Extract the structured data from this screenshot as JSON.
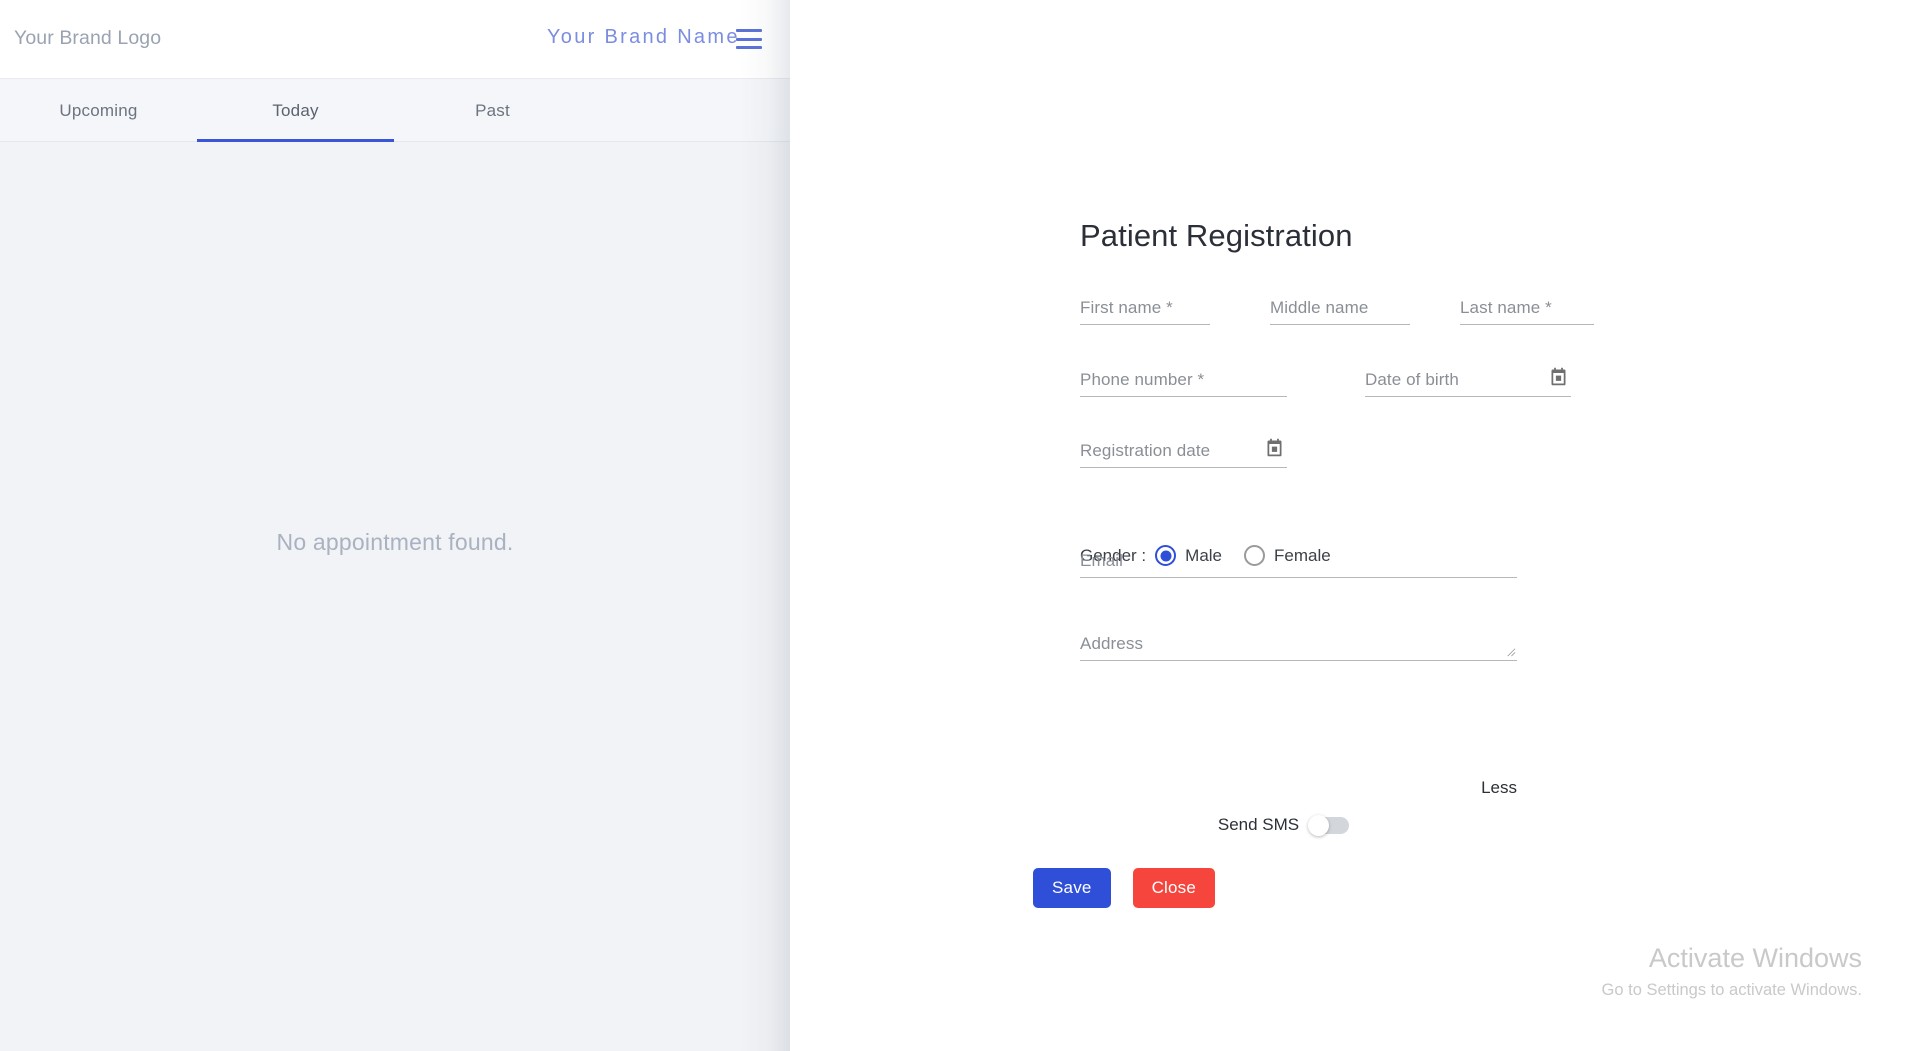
{
  "left_app": {
    "brand_logo": "Your Brand Logo",
    "brand_name": "Your Brand Name",
    "menu_icon": "hamburger-menu-icon",
    "tabs": [
      {
        "label": "Upcoming",
        "active": false
      },
      {
        "label": "Today",
        "active": true
      },
      {
        "label": "Past",
        "active": false
      }
    ],
    "empty_state": "No appointment found.",
    "accent_color": "#3b55d9",
    "brand_name_color": "#7b8de0",
    "background_color": "#f1f3f6"
  },
  "form": {
    "title": "Patient Registration",
    "fields": {
      "first_name": {
        "label": "First name *",
        "value": "",
        "required": true
      },
      "middle_name": {
        "label": "Middle name",
        "value": "",
        "required": false
      },
      "last_name": {
        "label": "Last name *",
        "value": "",
        "required": true
      },
      "phone": {
        "label": "Phone number *",
        "value": "",
        "required": true
      },
      "dob": {
        "label": "Date of birth",
        "value": "",
        "icon": "calendar-icon"
      },
      "reg_date": {
        "label": "Registration date",
        "value": "",
        "icon": "calendar-icon"
      },
      "email": {
        "label": "Email",
        "value": ""
      },
      "address": {
        "label": "Address",
        "value": ""
      }
    },
    "gender": {
      "label": "Gender :",
      "options": [
        {
          "label": "Male",
          "selected": true
        },
        {
          "label": "Female",
          "selected": false
        }
      ]
    },
    "toggle_link": "Less",
    "send_sms": {
      "label": "Send SMS",
      "on": false
    },
    "buttons": {
      "save": {
        "label": "Save",
        "color": "#2f4fd8"
      },
      "close": {
        "label": "Close",
        "color": "#f5453c"
      }
    }
  },
  "watermark": {
    "title": "Activate Windows",
    "subtitle": "Go to Settings to activate Windows."
  }
}
